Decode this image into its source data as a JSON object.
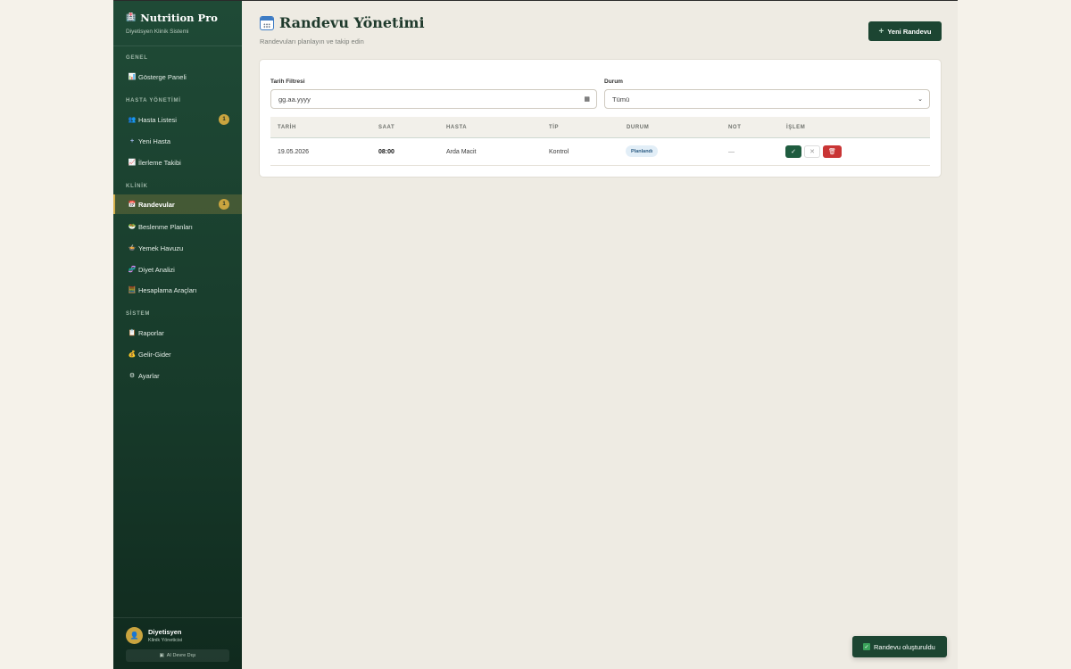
{
  "brand": {
    "title": "Nutrition Pro",
    "subtitle": "Diyetisyen Klinik Sistemi",
    "icon": "clinic-icon"
  },
  "sidebar": {
    "sections": [
      "GENEL",
      "HASTA YÖNETİMİ",
      "KLİNİK",
      "SİSTEM"
    ],
    "items": [
      {
        "label": "Gösterge Paneli",
        "icon": "chart-icon"
      },
      {
        "label": "Hasta Listesi",
        "icon": "people-icon",
        "badge": "1"
      },
      {
        "label": "Yeni Hasta",
        "icon": "plus-icon"
      },
      {
        "label": "İlerleme Takibi",
        "icon": "progress-chart-icon"
      },
      {
        "label": "Randevular",
        "icon": "calendar-icon",
        "badge": "1",
        "active": true
      },
      {
        "label": "Beslenme Planları",
        "icon": "plan-icon"
      },
      {
        "label": "Yemek Havuzu",
        "icon": "bowl-icon"
      },
      {
        "label": "Diyet Analizi",
        "icon": "dna-icon"
      },
      {
        "label": "Hesaplama Araçları",
        "icon": "calculator-icon"
      },
      {
        "label": "Raporlar",
        "icon": "report-icon"
      },
      {
        "label": "Gelir-Gider",
        "icon": "money-bag-icon"
      },
      {
        "label": "Ayarlar",
        "icon": "gear-icon"
      }
    ]
  },
  "user": {
    "name": "Diyetisyen",
    "role": "Klinik Yöneticisi",
    "logout": "AI Devre Dışı"
  },
  "header": {
    "title": "Randevu Yönetimi",
    "subtitle": "Randevuları planlayın ve takip edin",
    "new_button": "Yeni Randevu"
  },
  "filters": {
    "date_label": "Tarih Filtresi",
    "date_placeholder": "gg.aa.yyyy",
    "status_label": "Durum",
    "status_value": "Tümü"
  },
  "table": {
    "headers": [
      "TARİH",
      "SAAT",
      "HASTA",
      "TİP",
      "DURUM",
      "NOT",
      "İŞLEM"
    ],
    "rows": [
      {
        "date": "19.05.2026",
        "time": "08:00",
        "patient": "Arda Macit",
        "type": "Kontrol",
        "status": "Planlandı",
        "note": "—"
      }
    ]
  },
  "toast": {
    "message": "Randevu oluşturuldu"
  },
  "colors": {
    "sidebar": "#1f4a36",
    "accent": "#c9a43f",
    "primary": "#1c4532",
    "danger": "#c93535"
  }
}
